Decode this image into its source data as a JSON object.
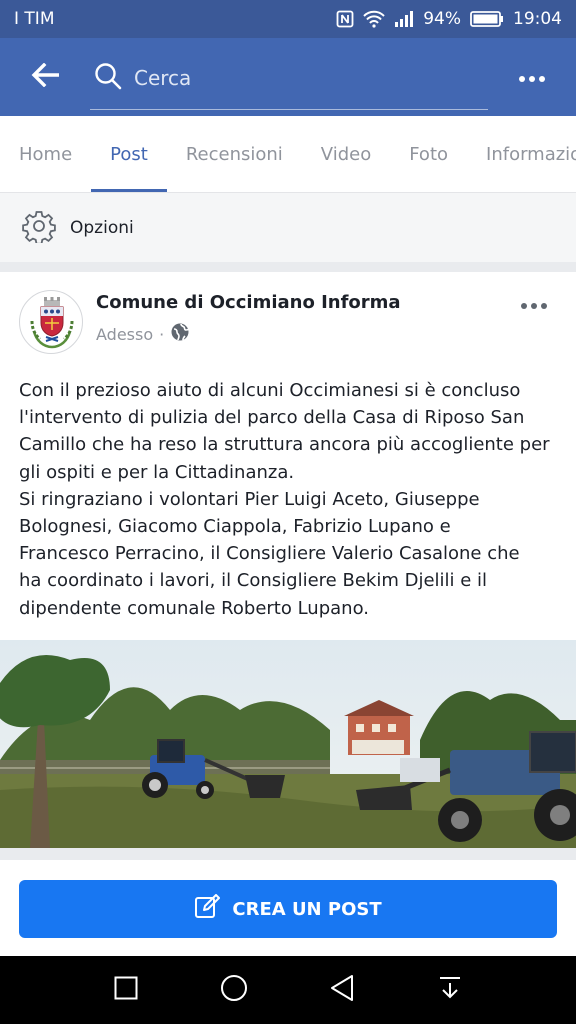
{
  "status_bar": {
    "carrier": "I TIM",
    "battery": "94%",
    "time": "19:04"
  },
  "app_bar": {
    "search_placeholder": "Cerca"
  },
  "tabs": [
    {
      "label": "Home"
    },
    {
      "label": "Post"
    },
    {
      "label": "Recensioni"
    },
    {
      "label": "Video"
    },
    {
      "label": "Foto"
    },
    {
      "label": "Informazio"
    }
  ],
  "options": {
    "label": "Opzioni"
  },
  "post": {
    "page_name": "Comune di Occimiano Informa",
    "timestamp": "Adesso",
    "separator": "·",
    "text": "Con il prezioso aiuto di alcuni Occimianesi si è concluso\nl'intervento di pulizia del parco della Casa di Riposo San\nCamillo che ha reso la struttura ancora più accogliente per\ngli ospiti e per la Cittadinanza.\nSi ringraziano i volontari Pier Luigi Aceto, Giuseppe\nBolognesi, Giacomo Ciappola, Fabrizio Lupano e\nFrancesco Perracino, il Consigliere Valerio Casalone che\nha coordinato i lavori, il Consigliere Bekim Djelili e il\ndipendente comunale Roberto Lupano."
  },
  "create_post": {
    "label": "CREA UN POST"
  },
  "colors": {
    "header": "#4267b2",
    "status": "#3b5998",
    "accent": "#1877f2"
  },
  "icons": [
    "back-arrow-icon",
    "search-icon",
    "more-icon",
    "gear-icon",
    "globe-icon",
    "edit-icon"
  ]
}
